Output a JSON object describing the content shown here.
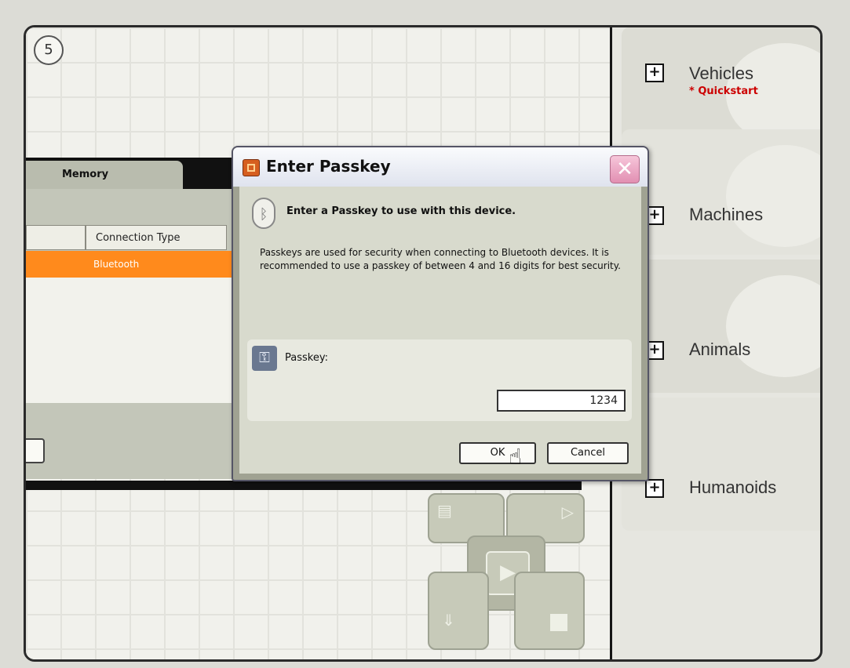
{
  "step_number": "5",
  "categories": [
    {
      "label": "Vehicles",
      "note": "* Quickstart"
    },
    {
      "label": "Machines"
    },
    {
      "label": "Animals"
    },
    {
      "label": "Humanoids"
    }
  ],
  "background_window": {
    "tab_label": "Memory",
    "column_header": "Connection Type",
    "selected_row": {
      "connection_type": "Bluetooth"
    }
  },
  "dialog": {
    "title": "Enter Passkey",
    "close_symbol": "✕",
    "heading": "Enter a Passkey to use with this device.",
    "description": "Passkeys are used for security when connecting to Bluetooth devices. It is recommended to use a passkey of between 4 and 16 digits for best security.",
    "passkey_label": "Passkey:",
    "passkey_value": "1234",
    "ok_label": "OK",
    "cancel_label": "Cancel"
  },
  "colors": {
    "selection": "#ff8a1c",
    "quickstart": "#cc0000"
  },
  "icons": [
    "plus-icon",
    "bluetooth-icon",
    "key-icon",
    "close-icon",
    "hand-cursor-icon",
    "play-icon"
  ]
}
